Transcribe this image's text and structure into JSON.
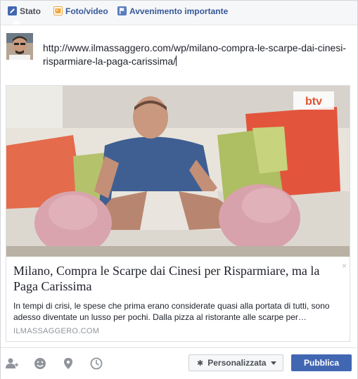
{
  "tabs": [
    {
      "label": "Stato",
      "icon": "pencil-icon",
      "active": true
    },
    {
      "label": "Foto/video",
      "icon": "photo-icon",
      "active": false
    },
    {
      "label": "Avvenimento importante",
      "icon": "flag-icon",
      "active": false
    }
  ],
  "composer": {
    "text": "http://www.ilmassaggero.com/wp/milano-compra-le-scarpe-dai-cinesi-risparmiare-la-paga-carissima/"
  },
  "preview": {
    "image_watermark": "barcroft tv",
    "close_glyph": "×",
    "title": "Milano, Compra le Scarpe dai Cinesi per Risparmiare, ma la Paga Carissima",
    "description": "In tempi di crisi, le spese che prima erano considerate quasi alla portata di tutti, sono adesso diventate un lusso per pochi. Dalla pizza al ristorante alle scarpe per…",
    "domain": "ILMASSAGGERO.COM"
  },
  "footer": {
    "icons": [
      "tag-friends-icon",
      "feeling-icon",
      "location-icon",
      "clock-icon"
    ],
    "privacy_label": "Personalizzata",
    "publish_label": "Pubblica"
  },
  "colors": {
    "brand_blue": "#4267b2",
    "link_blue": "#365899",
    "muted_gray": "#90949c"
  }
}
